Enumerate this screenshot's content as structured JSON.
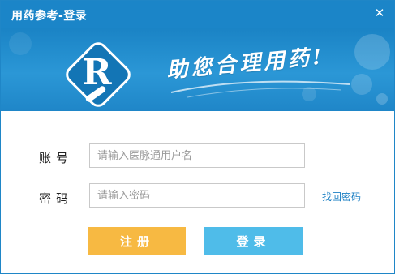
{
  "window": {
    "title": "用药参考-登录",
    "close_glyph": "✕"
  },
  "banner": {
    "logo_letter": "R",
    "slogan": "助您合理用药!",
    "colors": {
      "primary": "#1b85c8",
      "logo": "#1375b5"
    }
  },
  "form": {
    "account_label": "账号",
    "account_placeholder": "请输入医脉通用户名",
    "password_label": "密码",
    "password_placeholder": "请输入密码",
    "forgot_label": "找回密码"
  },
  "buttons": {
    "register_label": "注册",
    "login_label": "登录",
    "register_color": "#f7b942",
    "login_color": "#4fbce9"
  }
}
